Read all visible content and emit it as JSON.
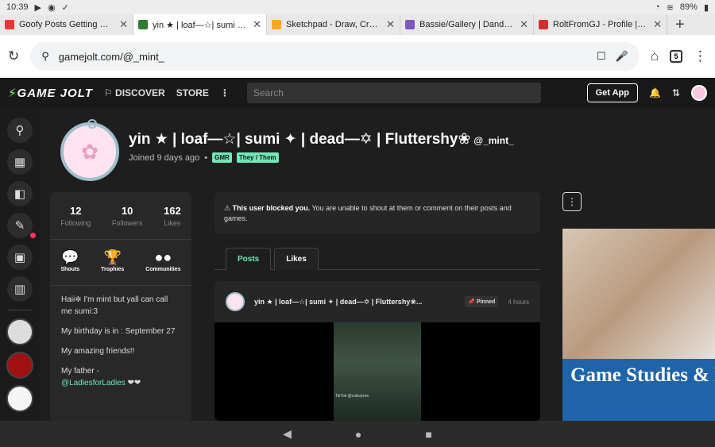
{
  "status": {
    "time": "10:39",
    "battery": "89%"
  },
  "tabs": [
    {
      "label": "Goofy Posts Getting Cooked",
      "favcolor": "#e53935"
    },
    {
      "label": "yin ★ | loaf—☆| sumi ✦ | dead",
      "favcolor": "#2e7d32"
    },
    {
      "label": "Sketchpad - Draw, Create, Sh",
      "favcolor": "#f9a825"
    },
    {
      "label": "Bassie/Gallery | Dandy's Wo",
      "favcolor": "#7e57c2"
    },
    {
      "label": "RoltFromGJ - Profile | Pinter",
      "favcolor": "#d32f2f"
    }
  ],
  "omnibox": {
    "url": "gamejolt.com/@_mint_",
    "tab_count": "5"
  },
  "gj_header": {
    "logo": "GAME JOLT",
    "discover": "DISCOVER",
    "store": "STORE",
    "search_placeholder": "Search",
    "get_app": "Get App"
  },
  "profile": {
    "name": "yin ★ | loaf—☆| sumi ✦ | dead—✡ | Fluttershy❀",
    "username": "@_mint_",
    "joined": "Joined 9 days ago",
    "tags": [
      "GMR",
      "They / Them"
    ]
  },
  "stats": [
    {
      "num": "12",
      "label": "Following"
    },
    {
      "num": "10",
      "label": "Followers"
    },
    {
      "num": "162",
      "label": "Likes"
    }
  ],
  "actions": [
    {
      "label": "Shouts",
      "icon": "💬"
    },
    {
      "label": "Trophies",
      "icon": "🏆"
    },
    {
      "label": "Communities",
      "icon": "●●"
    }
  ],
  "bio": {
    "line1": "Haii✲ I'm mint but yall can call me sumi:3",
    "line2": "My birthday is in : September 27",
    "line3": "My amazing friends!!",
    "line4": "My father -",
    "link": "@LadiesforLadies",
    "hearts": "❤❤"
  },
  "notice": {
    "bold": "This user blocked you.",
    "rest": " You are unable to shout at them or comment on their posts and games."
  },
  "post_tabs": {
    "posts": "Posts",
    "likes": "Likes"
  },
  "post": {
    "title": "yin ★ | loaf—☆| sumi ✦ | dead—✡ | Fluttershy❀...",
    "pinned": "Pinned",
    "time": "4 hours",
    "video_caption": "TikTok @cotezyme"
  },
  "ad": {
    "banner": "Game Studies & Design"
  }
}
